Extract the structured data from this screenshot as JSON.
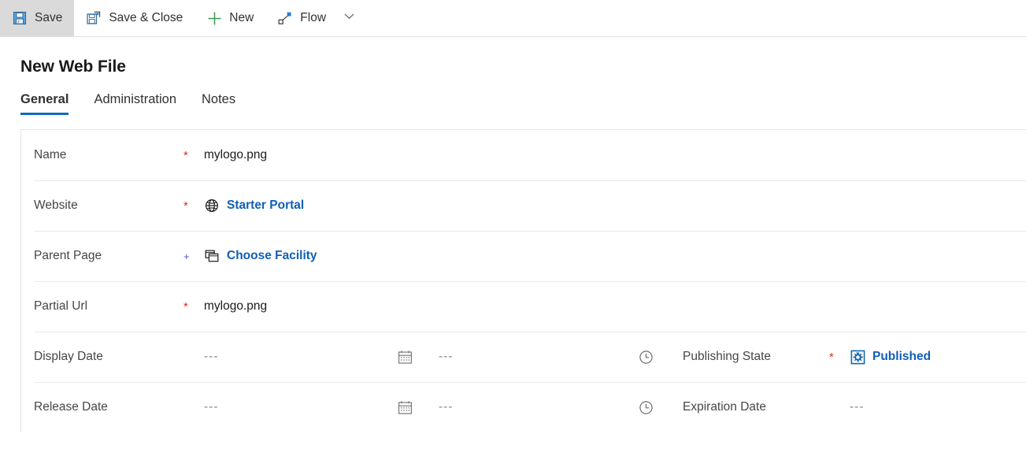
{
  "commandbar": {
    "buttons": [
      {
        "label": "Save",
        "icon": "save-icon",
        "active": true
      },
      {
        "label": "Save & Close",
        "icon": "save-close-icon",
        "active": false
      },
      {
        "label": "New",
        "icon": "plus-icon",
        "active": false
      },
      {
        "label": "Flow",
        "icon": "flow-icon",
        "active": false
      }
    ],
    "overflow_caret": "chevron-down-icon"
  },
  "page": {
    "title": "New Web File"
  },
  "tabs": [
    {
      "label": "General",
      "selected": true
    },
    {
      "label": "Administration",
      "selected": false
    },
    {
      "label": "Notes",
      "selected": false
    }
  ],
  "form": {
    "rows": [
      {
        "label": "Name",
        "marker": "*",
        "marker_kind": "required",
        "value": "mylogo.png",
        "value_kind": "text",
        "icon": null
      },
      {
        "label": "Website",
        "marker": "*",
        "marker_kind": "required",
        "value": "Starter Portal",
        "value_kind": "link",
        "icon": "globe-icon"
      },
      {
        "label": "Parent Page",
        "marker": "+",
        "marker_kind": "recommended",
        "value": "Choose Facility",
        "value_kind": "link",
        "icon": "pages-icon"
      },
      {
        "label": "Partial Url",
        "marker": "*",
        "marker_kind": "required",
        "value": "mylogo.png",
        "value_kind": "text",
        "icon": null
      }
    ],
    "date_rows": [
      {
        "label": "Display Date",
        "date_value": "---",
        "calendar_icon": "calendar-icon",
        "time_value": "---",
        "clock_icon": "clock-icon",
        "right_label": "Publishing State",
        "right_marker": "*",
        "right_marker_kind": "required",
        "right_value": "Published",
        "right_value_kind": "link",
        "right_icon": "publishing-state-icon"
      },
      {
        "label": "Release Date",
        "date_value": "---",
        "calendar_icon": "calendar-icon",
        "time_value": "---",
        "clock_icon": "clock-icon",
        "right_label": "Expiration Date",
        "right_marker": "",
        "right_marker_kind": "none",
        "right_value": "---",
        "right_value_kind": "empty",
        "right_icon": null
      }
    ]
  },
  "colors": {
    "accent_blue": "#0f6cbd",
    "link_blue": "#0f5fb8",
    "required_red": "#d93025",
    "recommended_blue": "#4f52d6",
    "new_green": "#3a9b53",
    "icon_blue": "#2b7cd3",
    "divider": "#e8e8e8",
    "active_btn_bg": "#dadada"
  }
}
